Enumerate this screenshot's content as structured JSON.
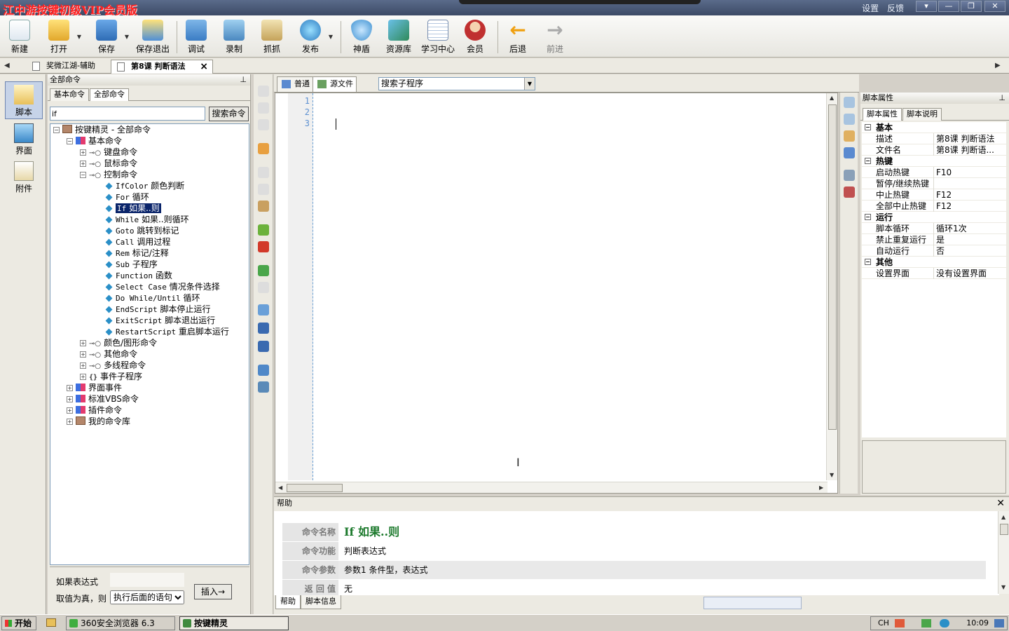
{
  "window": {
    "title": "江中游按键初级VIP会员版",
    "links": [
      "设置",
      "反馈"
    ],
    "controls": [
      "▾",
      "—",
      "❐",
      "✕"
    ]
  },
  "toolbar": {
    "buttons": [
      {
        "label": "新建",
        "icon": "new-file-icon"
      },
      {
        "label": "打开",
        "icon": "open-folder-icon"
      },
      {
        "label": "保存",
        "icon": "save-disk-icon"
      },
      {
        "label": "保存退出",
        "icon": "save-exit-icon"
      },
      {
        "label": "调试",
        "icon": "debug-icon"
      },
      {
        "label": "录制",
        "icon": "record-camera-icon"
      },
      {
        "label": "抓抓",
        "icon": "grab-tool-icon"
      },
      {
        "label": "发布",
        "icon": "publish-globe-icon"
      },
      {
        "label": "神盾",
        "icon": "shield-icon"
      },
      {
        "label": "资源库",
        "icon": "resource-library-icon"
      },
      {
        "label": "学习中心",
        "icon": "learning-center-icon"
      },
      {
        "label": "会员",
        "icon": "member-icon"
      },
      {
        "label": "后退",
        "icon": "back-arrow-icon"
      },
      {
        "label": "前进",
        "icon": "forward-arrow-icon"
      }
    ]
  },
  "doc_tabs": {
    "items": [
      "奖微江湖-辅助",
      "第8课 判断语法"
    ],
    "active_index": 1,
    "close": "×"
  },
  "left_strip": {
    "items": [
      {
        "label": "脚本",
        "icon": "script-icon"
      },
      {
        "label": "界面",
        "icon": "ui-window-icon"
      },
      {
        "label": "附件",
        "icon": "attachment-icon"
      }
    ]
  },
  "command_panel": {
    "header": "全部命令",
    "pin": "⊥",
    "tabs": [
      "基本命令",
      "全部命令"
    ],
    "search_value": "if",
    "search_button": "搜索命令",
    "tree": {
      "root": "按键精灵 - 全部命令",
      "basic": "基本命令",
      "keyboard": "键盘命令",
      "mouse": "鼠标命令",
      "control": "控制命令",
      "control_items": [
        {
          "code": "IfColor",
          "desc": "颜色判断"
        },
        {
          "code": "For",
          "desc": "循环"
        },
        {
          "code": "If",
          "desc": "如果..则"
        },
        {
          "code": "While",
          "desc": "如果..则循环"
        },
        {
          "code": "Goto",
          "desc": "跳转到标记"
        },
        {
          "code": "Call",
          "desc": "调用过程"
        },
        {
          "code": "Rem",
          "desc": "标记/注释"
        },
        {
          "code": "Sub",
          "desc": "子程序"
        },
        {
          "code": "Function",
          "desc": "函数"
        },
        {
          "code": "Select Case",
          "desc": "情况条件选择"
        },
        {
          "code": "Do While/Until",
          "desc": "循环"
        },
        {
          "code": "EndScript",
          "desc": "脚本停止运行"
        },
        {
          "code": "ExitScript",
          "desc": "脚本退出运行"
        },
        {
          "code": "RestartScript",
          "desc": "重启脚本运行"
        }
      ],
      "selected_index": 2,
      "after_control": [
        "颜色/图形命令",
        "其他命令",
        "多线程命令"
      ],
      "event_sub": "事件子程序",
      "brace": "{}",
      "top_level": [
        "界面事件",
        "标准VBS命令",
        "插件命令"
      ],
      "my_lib": "我的命令库"
    },
    "param": {
      "condition_label": "如果表达式",
      "true_label": "取值为真，则",
      "select_value": "执行后面的语句",
      "insert_button": "插入→"
    }
  },
  "editor": {
    "tabs": [
      {
        "label": "普通",
        "icon": "normal-view-icon"
      },
      {
        "label": "源文件",
        "icon": "source-file-icon"
      }
    ],
    "active_tab": 1,
    "subroutine_select": "搜索子程序",
    "line_numbers": [
      "1",
      "2",
      "3"
    ],
    "scroll_arrows": [
      "▲",
      "▼",
      "◀",
      "▶"
    ]
  },
  "properties": {
    "header": "脚本属性",
    "pin": "⊥",
    "tabs": [
      "脚本属性",
      "脚本说明"
    ],
    "groups": [
      {
        "name": "基本",
        "rows": [
          {
            "key": "描述",
            "value": "第8课 判断语法"
          },
          {
            "key": "文件名",
            "value": "第8课 判断语..."
          }
        ]
      },
      {
        "name": "热键",
        "rows": [
          {
            "key": "启动热键",
            "value": "F10"
          },
          {
            "key": "暂停/继续热键",
            "value": ""
          },
          {
            "key": "中止热键",
            "value": "F12"
          },
          {
            "key": "全部中止热键",
            "value": "F12"
          }
        ]
      },
      {
        "name": "运行",
        "rows": [
          {
            "key": "脚本循环",
            "value": "循环1次"
          },
          {
            "key": "禁止重复运行",
            "value": "是"
          },
          {
            "key": "自动运行",
            "value": "否"
          }
        ]
      },
      {
        "name": "其他",
        "rows": [
          {
            "key": "设置界面",
            "value": "没有设置界面"
          }
        ]
      }
    ]
  },
  "help": {
    "header": "帮助",
    "close": "✕",
    "rows": [
      {
        "key": "命令名称",
        "value": "If 如果..则"
      },
      {
        "key": "命令功能",
        "value": "判断表达式"
      },
      {
        "key": "命令参数",
        "value": "参数1 条件型，表达式"
      },
      {
        "key": "返 回 值",
        "value": "无"
      }
    ],
    "tabs": [
      "帮助",
      "脚本信息"
    ]
  },
  "taskbar": {
    "start": "开始",
    "tasks": [
      "360安全浏览器 6.3",
      "按键精灵"
    ],
    "active_task": 1,
    "lang": "CH",
    "clock": "10:09"
  }
}
